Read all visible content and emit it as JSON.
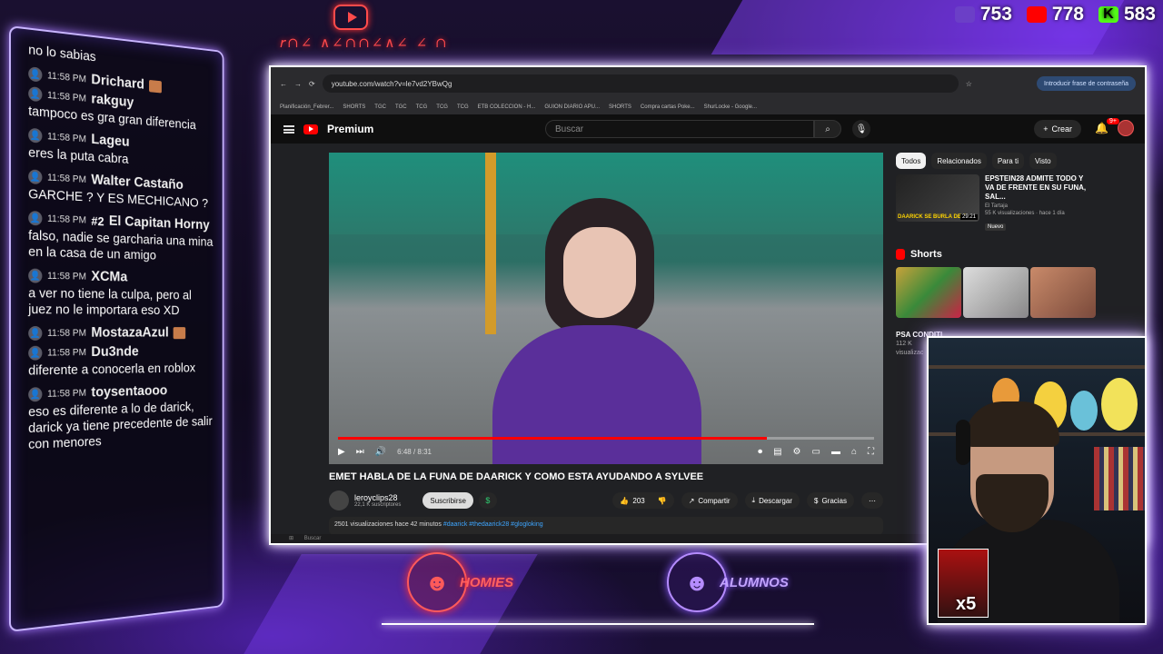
{
  "overlay": {
    "counters": [
      {
        "icon": "twitch-icon",
        "value": "753",
        "color": "#6b3fc7"
      },
      {
        "icon": "youtube-icon",
        "value": "778",
        "color": "#ff0000"
      },
      {
        "icon": "kick-icon",
        "value": "583",
        "color": "#53fc18"
      }
    ],
    "logo_homies": "HOMIES",
    "logo_alumnos": "ALUMNOS",
    "webcam_sub_badge": "x5"
  },
  "chat": {
    "partial_top": "no lo sabias",
    "messages": [
      {
        "time": "11:58 PM",
        "user": "Drichard",
        "text": "",
        "emote": true
      },
      {
        "time": "11:58 PM",
        "user": "rakguy",
        "text": "tampoco es gra gran diferencia"
      },
      {
        "time": "11:58 PM",
        "user": "Lageu",
        "text": "eres la puta cabra"
      },
      {
        "time": "11:58 PM",
        "user": "Walter Castaño",
        "text": "GARCHE ? Y ES MECHICANO ?"
      },
      {
        "time": "11:58 PM",
        "user": "El Capitan Horny",
        "badge": "#2",
        "text": "falso, nadie se garcharia una mina en la casa de un amigo"
      },
      {
        "time": "11:58 PM",
        "user": "XCMa",
        "text": "a ver no tiene la culpa, pero al juez no le importara eso XD"
      },
      {
        "time": "11:58 PM",
        "user": "MostazaAzul",
        "text": "",
        "emote": true
      },
      {
        "time": "11:58 PM",
        "user": "Du3nde",
        "text": "diferente a conocerla en roblox"
      },
      {
        "time": "11:58 PM",
        "user": "toysentaooo",
        "text": "eso es diferente a lo de darick, darick ya tiene precedente de salir con menores"
      }
    ]
  },
  "browser": {
    "url": "youtube.com/watch?v=le7vd2YBwQg",
    "password_button": "Introducir frase de contraseña",
    "bookmarks": [
      "Planificación_Febrer...",
      "SHORTS",
      "TGC",
      "TGC",
      "TCG",
      "TCG",
      "TCG",
      "ETB COLECCION - H...",
      "GUION DIARIO APU...",
      "SHORTS",
      "Compra cartas Poke...",
      "ShurLocke - Google..."
    ],
    "taskbar_search": "Buscar"
  },
  "youtube": {
    "brand": "Premium",
    "search_placeholder": "Buscar",
    "create_label": "Crear",
    "notif_count": "9+",
    "player": {
      "time": "6:48 / 8:31",
      "progress": 0.8
    },
    "title": "EMET HABLA DE LA FUNA DE DAARICK Y COMO ESTA AYUDANDO A SYLVEE",
    "channel": {
      "name": "leroyclips28",
      "subs": "22,1 K suscriptores"
    },
    "subscribe_label": "Suscribirse",
    "likes": "203",
    "share_label": "Compartir",
    "download_label": "Descargar",
    "thanks_label": "Gracias",
    "description": {
      "stats": "2501 visualizaciones  hace 42 minutos",
      "tags": "#daarick #thedaarick28 #glogloking"
    },
    "side": {
      "chips": [
        "Todos",
        "Relacionados",
        "Para ti",
        "Visto"
      ],
      "rec": {
        "title": "EPSTEIN28 ADMITE TODO Y VA DE FRENTE EN SU FUNA, SAL...",
        "channel": "El Tartaja",
        "meta": "55 K visualizaciones · hace 1 día",
        "badge": "Nuevo",
        "thumb_text": "DAARICK SE BURLA DE S",
        "duration": "29:21"
      },
      "shorts_heading": "Shorts",
      "short_title": "PSA CONDITI",
      "short_views": "112 K",
      "short_meta": "visualizac"
    }
  }
}
